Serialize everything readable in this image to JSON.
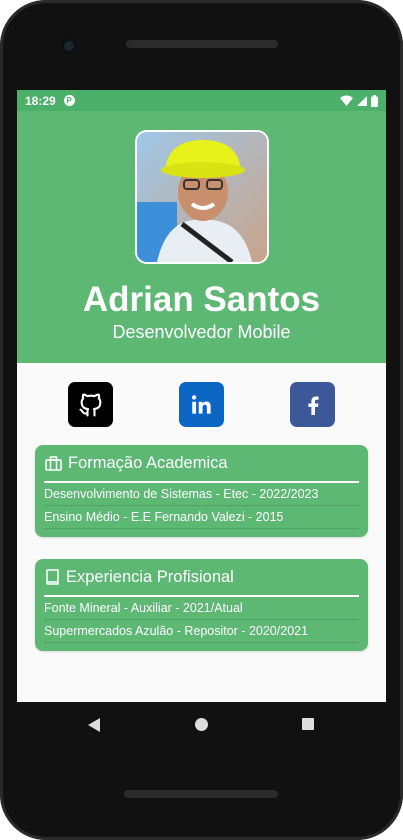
{
  "status": {
    "time": "18:29",
    "app_glyph": "P"
  },
  "profile": {
    "name": "Adrian Santos",
    "role": "Desenvolvedor Mobile"
  },
  "socials": [
    {
      "icon": "github-icon",
      "color": "#000000"
    },
    {
      "icon": "linkedin-icon",
      "color": "#0a66c2"
    },
    {
      "icon": "facebook-icon",
      "color": "#3b5998"
    }
  ],
  "education": {
    "title": "Formação Academica",
    "icon": "briefcase-icon",
    "items": [
      "Desenvolvimento de Sistemas - Etec - 2022/2023",
      "Ensino Médio - E.E Fernando Valezi - 2015"
    ]
  },
  "experience": {
    "title": "Experiencia Profisional",
    "icon": "book-icon",
    "items": [
      "Fonte Mineral - Auxiliar - 2021/Atual",
      "Supermercados Azulão - Repositor - 2020/2021"
    ]
  },
  "colors": {
    "primary": "#5db874",
    "statusbar": "#4caf6a"
  }
}
